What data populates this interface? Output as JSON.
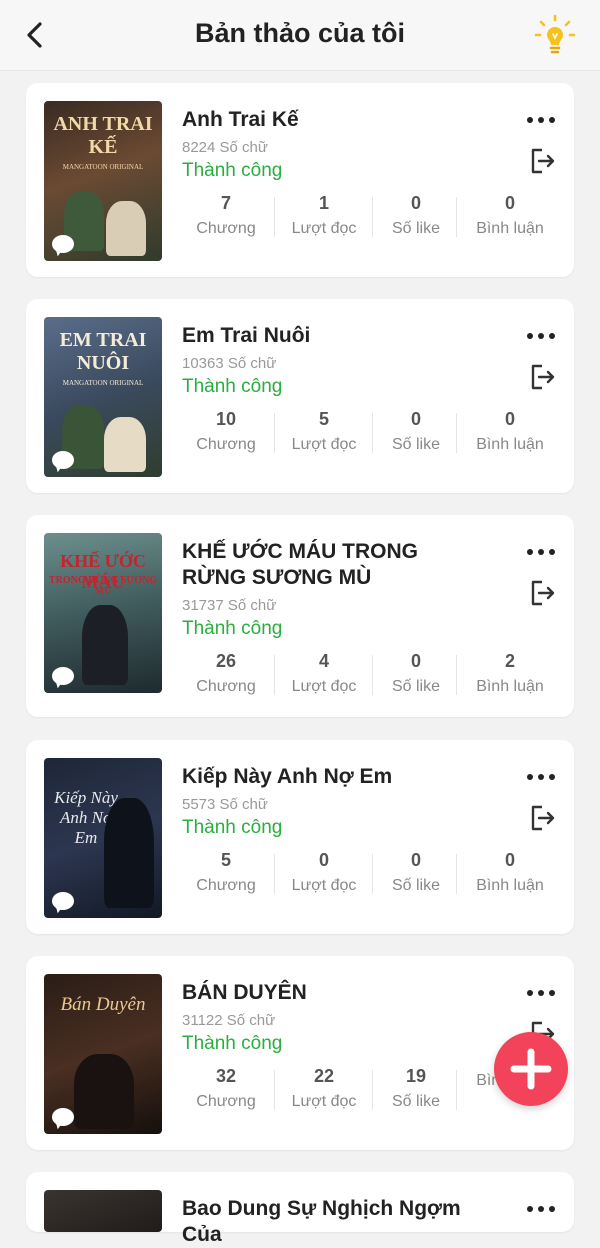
{
  "header": {
    "title": "Bản thảo của tôi"
  },
  "colors": {
    "accent": "#f2435b",
    "success": "#2aaf3f",
    "bulb": "#f6c21b"
  },
  "books": [
    {
      "title": "Anh Trai Kế",
      "word_count": "8224 Số chữ",
      "status": "Thành công",
      "cover_text": "ANH TRAI KẾ",
      "cover_sub": "MANGATOON ORIGINAL",
      "stats": [
        {
          "value": "7",
          "label": "Chương"
        },
        {
          "value": "1",
          "label": "Lượt đọc"
        },
        {
          "value": "0",
          "label": "Số like"
        },
        {
          "value": "0",
          "label": "Bình luận"
        }
      ]
    },
    {
      "title": "Em Trai Nuôi",
      "word_count": "10363 Số chữ",
      "status": "Thành công",
      "cover_text": "EM TRAI NUÔI",
      "cover_sub": "MANGATOON ORIGINAL",
      "stats": [
        {
          "value": "10",
          "label": "Chương"
        },
        {
          "value": "5",
          "label": "Lượt đọc"
        },
        {
          "value": "0",
          "label": "Số like"
        },
        {
          "value": "0",
          "label": "Bình luận"
        }
      ]
    },
    {
      "title": "KHẾ ƯỚC MÁU TRONG RỪNG SƯƠNG MÙ",
      "word_count": "31737 Số chữ",
      "status": "Thành công",
      "cover_text": "KHẾ ƯỚC MÁU",
      "cover_sub": "TRONG RỪNG SƯƠNG MÙ",
      "stats": [
        {
          "value": "26",
          "label": "Chương"
        },
        {
          "value": "4",
          "label": "Lượt đọc"
        },
        {
          "value": "0",
          "label": "Số like"
        },
        {
          "value": "2",
          "label": "Bình luận"
        }
      ]
    },
    {
      "title": "Kiếp Này Anh Nợ Em",
      "word_count": "5573 Số chữ",
      "status": "Thành công",
      "cover_text": "Kiếp Này Anh Nợ Em",
      "cover_sub": "",
      "stats": [
        {
          "value": "5",
          "label": "Chương"
        },
        {
          "value": "0",
          "label": "Lượt đọc"
        },
        {
          "value": "0",
          "label": "Số like"
        },
        {
          "value": "0",
          "label": "Bình luận"
        }
      ]
    },
    {
      "title": "BÁN DUYÊN",
      "word_count": "31122 Số chữ",
      "status": "Thành công",
      "cover_text": "Bán Duyên",
      "cover_sub": "",
      "stats": [
        {
          "value": "32",
          "label": "Chương"
        },
        {
          "value": "22",
          "label": "Lượt đọc"
        },
        {
          "value": "19",
          "label": "Số like"
        },
        {
          "value": "",
          "label": "Bình luận"
        }
      ]
    },
    {
      "title": "Bao Dung Sự Nghịch Ngợm Của",
      "word_count": "",
      "status": "",
      "stats": []
    }
  ]
}
